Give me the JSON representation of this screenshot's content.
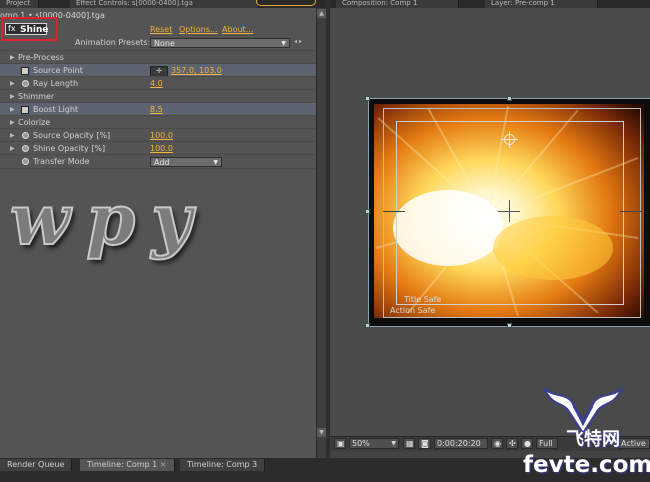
{
  "top_tabs": {
    "project": "Project",
    "effect_controls": "Effect Controls: s[0000-0400].tga",
    "composition": "Composition: Comp 1",
    "layer": "Layer: Pre-comp 1"
  },
  "effect_controls": {
    "layer_line": "omp 1 • s[0000-0400].tga",
    "effect_name": "Shine",
    "fx_glyph": "fx",
    "reset_label": "Reset",
    "options_label": "Options...",
    "about_label": "About...",
    "presets_label": "Animation Presets:",
    "presets_value": "None",
    "rows": {
      "preprocess": "Pre-Process",
      "source_point": "Source Point",
      "source_point_value": "357.0, 103.0",
      "ray_length": "Ray Length",
      "ray_length_value": "4.0",
      "shimmer": "Shimmer",
      "boost_light": "Boost Light",
      "boost_light_value": "8.5",
      "colorize": "Colorize",
      "source_opacity": "Source Opacity [%]",
      "source_opacity_value": "100.0",
      "shine_opacity": "Shine Opacity [%]",
      "shine_opacity_value": "100.0",
      "transfer_mode": "Transfer Mode",
      "transfer_mode_value": "Add"
    }
  },
  "canvas_text": "wpy",
  "composition_viewer": {
    "title_safe": "Title Safe",
    "action_safe": "Action Safe",
    "zoom": "50%",
    "timecode": "0:00:20:20",
    "resolution": "Full",
    "camera": "Active Ca"
  },
  "bottom_tabs": {
    "render_queue": "Render Queue",
    "timeline_comp1": "Timeline: Comp 1",
    "timeline_comp3": "Timeline: Comp 3"
  },
  "watermark": {
    "text": "fevte.com",
    "cn": "飞特网"
  },
  "colors": {
    "accent_value": "#f4b33b",
    "highlight_box": "#e0202c",
    "panel_bg": "#545454"
  }
}
